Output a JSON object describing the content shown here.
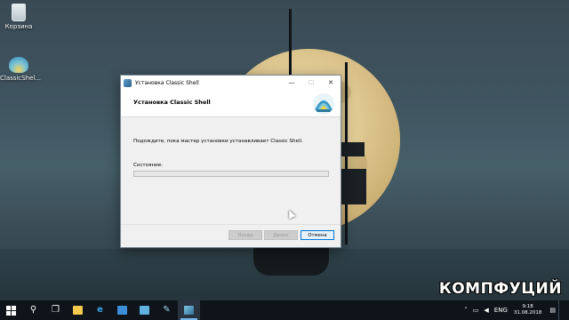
{
  "desktop": {
    "icons": [
      {
        "label": "Корзина",
        "icon": "recycle-bin-icon"
      },
      {
        "label": "ClassicShel...",
        "icon": "classic-shell-icon"
      }
    ]
  },
  "window": {
    "title": "Установка Classic Shell",
    "header_title": "Установка Classic Shell",
    "message": "Подождите, пока мастер установки устанавливает Classic Shell.",
    "status_label": "Состояние:",
    "progress_fraction": 0.0,
    "buttons": {
      "back": "Назад",
      "next": "Далее",
      "cancel": "Отмена"
    },
    "controls": {
      "minimize": "—",
      "maximize": "☐",
      "close": "✕"
    }
  },
  "watermark": "КОМПФУЦИЙ",
  "taskbar": {
    "items": [
      "start-icon",
      "search-icon",
      "task-view-icon",
      "file-explorer-icon",
      "edge-icon",
      "store-icon",
      "app-icon",
      "app-icon-2",
      "classic-shell-setup-icon"
    ],
    "tray": {
      "language": "ENG",
      "time": "9:18",
      "date": "31.08.2018"
    }
  }
}
